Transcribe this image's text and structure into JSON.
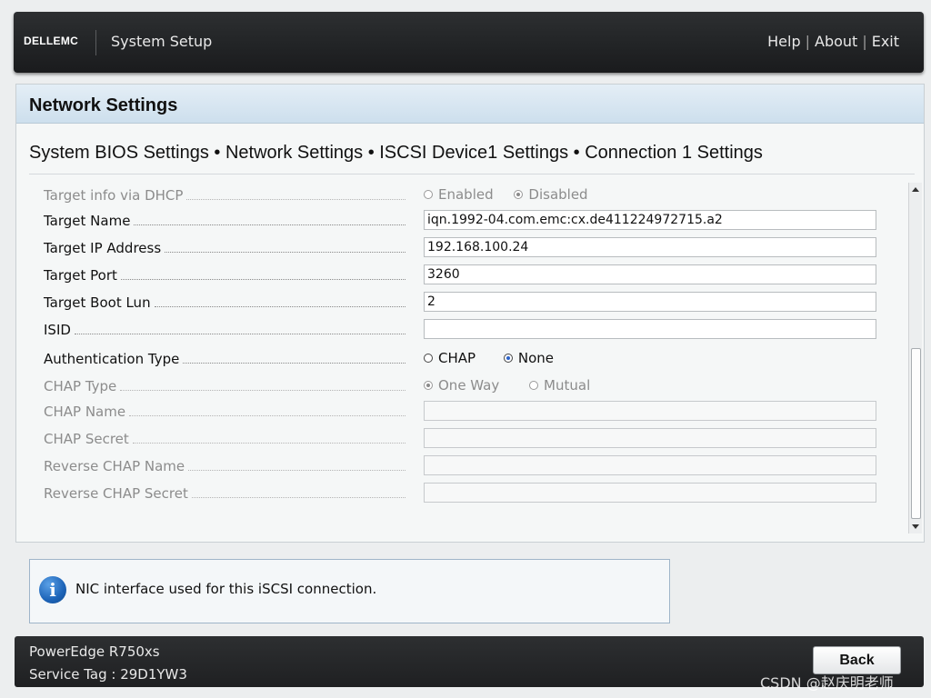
{
  "header": {
    "logo_text": "DELLEMC",
    "app_title": "System Setup",
    "links": {
      "help": "Help",
      "about": "About",
      "exit": "Exit",
      "separator": "|"
    }
  },
  "page": {
    "title": "Network Settings",
    "breadcrumb": "System BIOS Settings • Network Settings • ISCSI Device1 Settings • Connection 1 Settings"
  },
  "form": {
    "target_info_dhcp": {
      "label": "Target info via DHCP",
      "options": [
        "Enabled",
        "Disabled"
      ],
      "selected": "Disabled",
      "enabled": false
    },
    "target_name": {
      "label": "Target Name",
      "value": "iqn.1992-04.com.emc:cx.de411224972715.a2"
    },
    "target_ip": {
      "label": "Target IP Address",
      "value": "192.168.100.24"
    },
    "target_port": {
      "label": "Target Port",
      "value": "3260"
    },
    "target_boot_lun": {
      "label": "Target Boot Lun",
      "value": "2"
    },
    "isid": {
      "label": "ISID",
      "value": ""
    },
    "auth_type": {
      "label": "Authentication Type",
      "options": [
        "CHAP",
        "None"
      ],
      "selected": "None",
      "enabled": true
    },
    "chap_type": {
      "label": "CHAP Type",
      "options": [
        "One Way",
        "Mutual"
      ],
      "selected": "One Way",
      "enabled": false
    },
    "chap_name": {
      "label": "CHAP Name",
      "value": "",
      "enabled": false
    },
    "chap_secret": {
      "label": "CHAP Secret",
      "value": "",
      "enabled": false
    },
    "reverse_chap_name": {
      "label": "Reverse CHAP Name",
      "value": "",
      "enabled": false
    },
    "reverse_chap_secret": {
      "label": "Reverse CHAP Secret",
      "value": "",
      "enabled": false
    }
  },
  "help": {
    "icon": "info-icon",
    "text": "NIC interface used for this iSCSI connection."
  },
  "footer": {
    "model": "PowerEdge R750xs",
    "service_tag": "Service Tag : 29D1YW3",
    "back_label": "Back"
  },
  "watermark": "CSDN @赵庆明老师",
  "colors": {
    "header_bg": "#232527",
    "panel_header": "#d4e4f0",
    "radio_selected": "#2a62c9",
    "info_icon": "#1d64b8"
  }
}
